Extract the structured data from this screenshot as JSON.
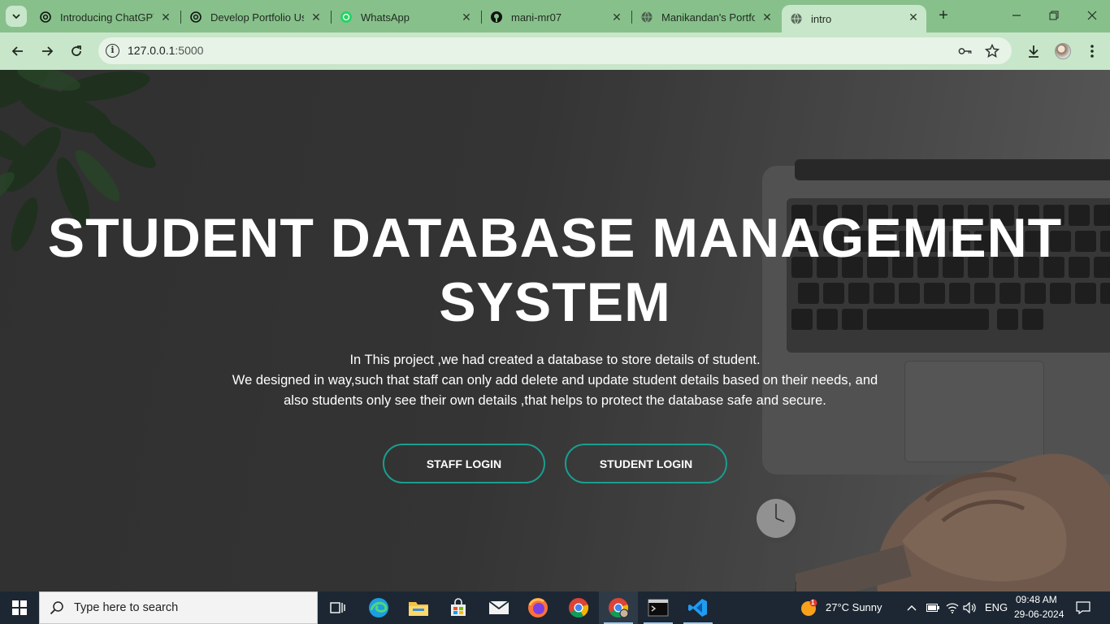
{
  "browser": {
    "tabs": [
      {
        "title": "Introducing ChatGPT",
        "favicon": "chatgpt-icon",
        "active": false
      },
      {
        "title": "Develop Portfolio Usi",
        "favicon": "chatgpt-icon",
        "active": false
      },
      {
        "title": "WhatsApp",
        "favicon": "whatsapp-icon",
        "active": false
      },
      {
        "title": "mani-mr07",
        "favicon": "github-icon",
        "active": false
      },
      {
        "title": "Manikandan's Portfol",
        "favicon": "globe-icon",
        "active": false
      },
      {
        "title": "intro",
        "favicon": "globe-icon",
        "active": true
      }
    ],
    "address": {
      "host": "127.0.0.1",
      "port": ":5000"
    },
    "theme_color": "#87c08b",
    "toolbar_color": "#c8e6c9"
  },
  "hero": {
    "title_line1": "STUDENT DATABASE MANAGEMENT",
    "title_line2": "SYSTEM",
    "desc_line1": "In This project ,we had created a database to store details of student.",
    "desc_line2": "We designed in way,such that staff can only add delete and update student details based on their needs, and",
    "desc_line3": "also students only see their own details ,that helps to protect the database safe and secure.",
    "staff_button": "STAFF LOGIN",
    "student_button": "STUDENT LOGIN",
    "button_border_color": "#1a9e8f"
  },
  "taskbar": {
    "search_placeholder": "Type here to search",
    "weather": "27°C  Sunny",
    "language": "ENG",
    "time": "09:48 AM",
    "date": "29-06-2024",
    "weather_badge": "1"
  }
}
